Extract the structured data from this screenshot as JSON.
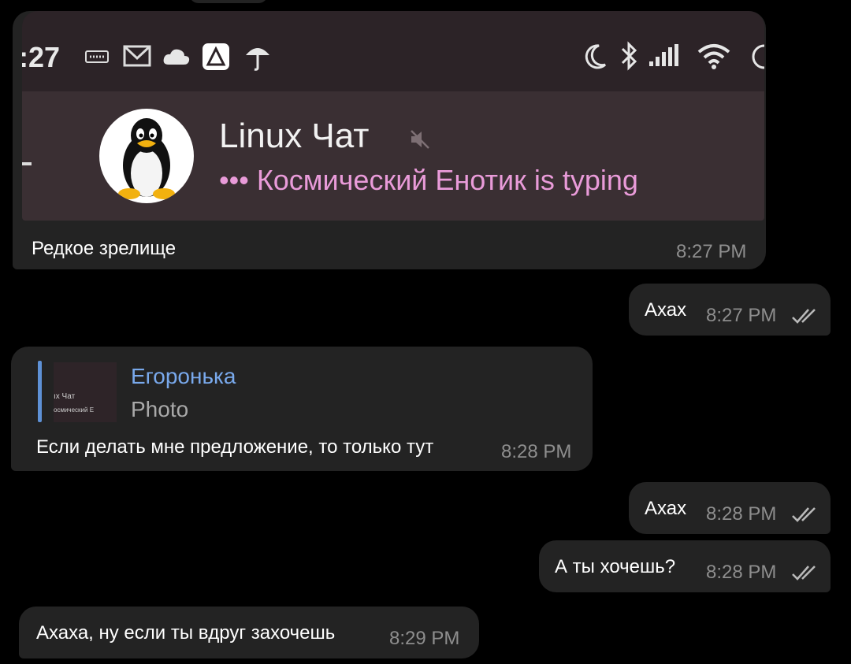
{
  "embedded_screenshot": {
    "status_time": ":27",
    "chat_title": "Linux Чат",
    "typing_status": "••• Космический Енотик is typing"
  },
  "messages": [
    {
      "id": "m1",
      "direction": "incoming",
      "text": "Редкое зрелище",
      "time": "8:27 PM"
    },
    {
      "id": "m2",
      "direction": "outgoing",
      "text": "Ахах",
      "time": "8:27 PM",
      "status": "read"
    },
    {
      "id": "m3",
      "direction": "incoming",
      "reply_to": {
        "author": "Егоронька",
        "preview": "Photo",
        "thumb_line1": "ıx Чат",
        "thumb_line2": "осмический Е"
      },
      "text": "Если делать мне предложение, то только тут",
      "time": "8:28 PM"
    },
    {
      "id": "m4",
      "direction": "outgoing",
      "text": "Ахах",
      "time": "8:28 PM",
      "status": "read"
    },
    {
      "id": "m5",
      "direction": "outgoing",
      "text": "А ты хочешь?",
      "time": "8:28 PM",
      "status": "read"
    },
    {
      "id": "m6",
      "direction": "incoming",
      "text": "Ахаха, ну если ты вдруг захочешь",
      "time": "8:29 PM"
    }
  ],
  "colors": {
    "background": "#000000",
    "bubble": "#232323",
    "reply_accent": "#5e91d6",
    "typing_accent": "#e99bd9",
    "time": "#8e8e8e"
  }
}
